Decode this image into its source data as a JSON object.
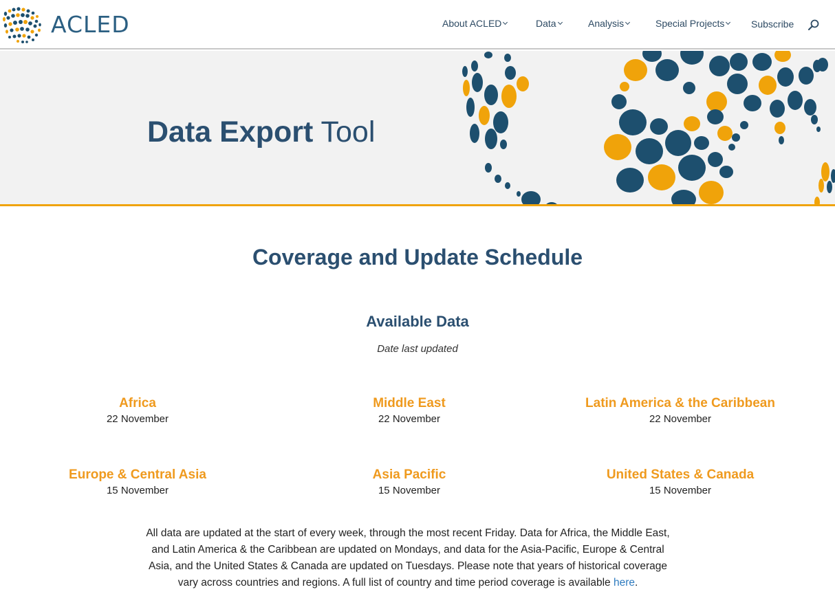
{
  "header": {
    "logo_text": "ACLED",
    "nav": [
      {
        "label": "About ACLED"
      },
      {
        "label": "Data"
      },
      {
        "label": "Analysis"
      },
      {
        "label": "Special Projects"
      }
    ],
    "subscribe_label": "Subscribe",
    "search_icon": "search-icon"
  },
  "hero": {
    "title_bold": "Data Export",
    "title_light": "Tool"
  },
  "coverage": {
    "title": "Coverage and Update Schedule",
    "available_title": "Available Data",
    "available_subtitle": "Date last updated",
    "regions": [
      {
        "name": "Africa",
        "date": "22 November"
      },
      {
        "name": "Middle East",
        "date": "22 November"
      },
      {
        "name": "Latin America & the Caribbean",
        "date": "22 November"
      },
      {
        "name": "Europe & Central Asia",
        "date": "15 November"
      },
      {
        "name": "Asia Pacific",
        "date": "15 November"
      },
      {
        "name": "United States & Canada",
        "date": "15 November"
      }
    ],
    "note_text": "All data are updated at the start of every week, through the most recent Friday. Data for Africa, the Middle East, and Latin America & the Caribbean are updated on Mondays, and data for the Asia-Pacific, Europe & Central Asia, and the United States & Canada are updated on Tuesdays. Please note that years of historical coverage vary across countries and regions. A full list of country and time period coverage is available ",
    "note_link": "here",
    "note_end": "."
  },
  "colors": {
    "navy": "#2b4f70",
    "accent_orange": "#f0a30a",
    "dot_blue": "#1d4f6e",
    "link": "#2e7bbf"
  }
}
